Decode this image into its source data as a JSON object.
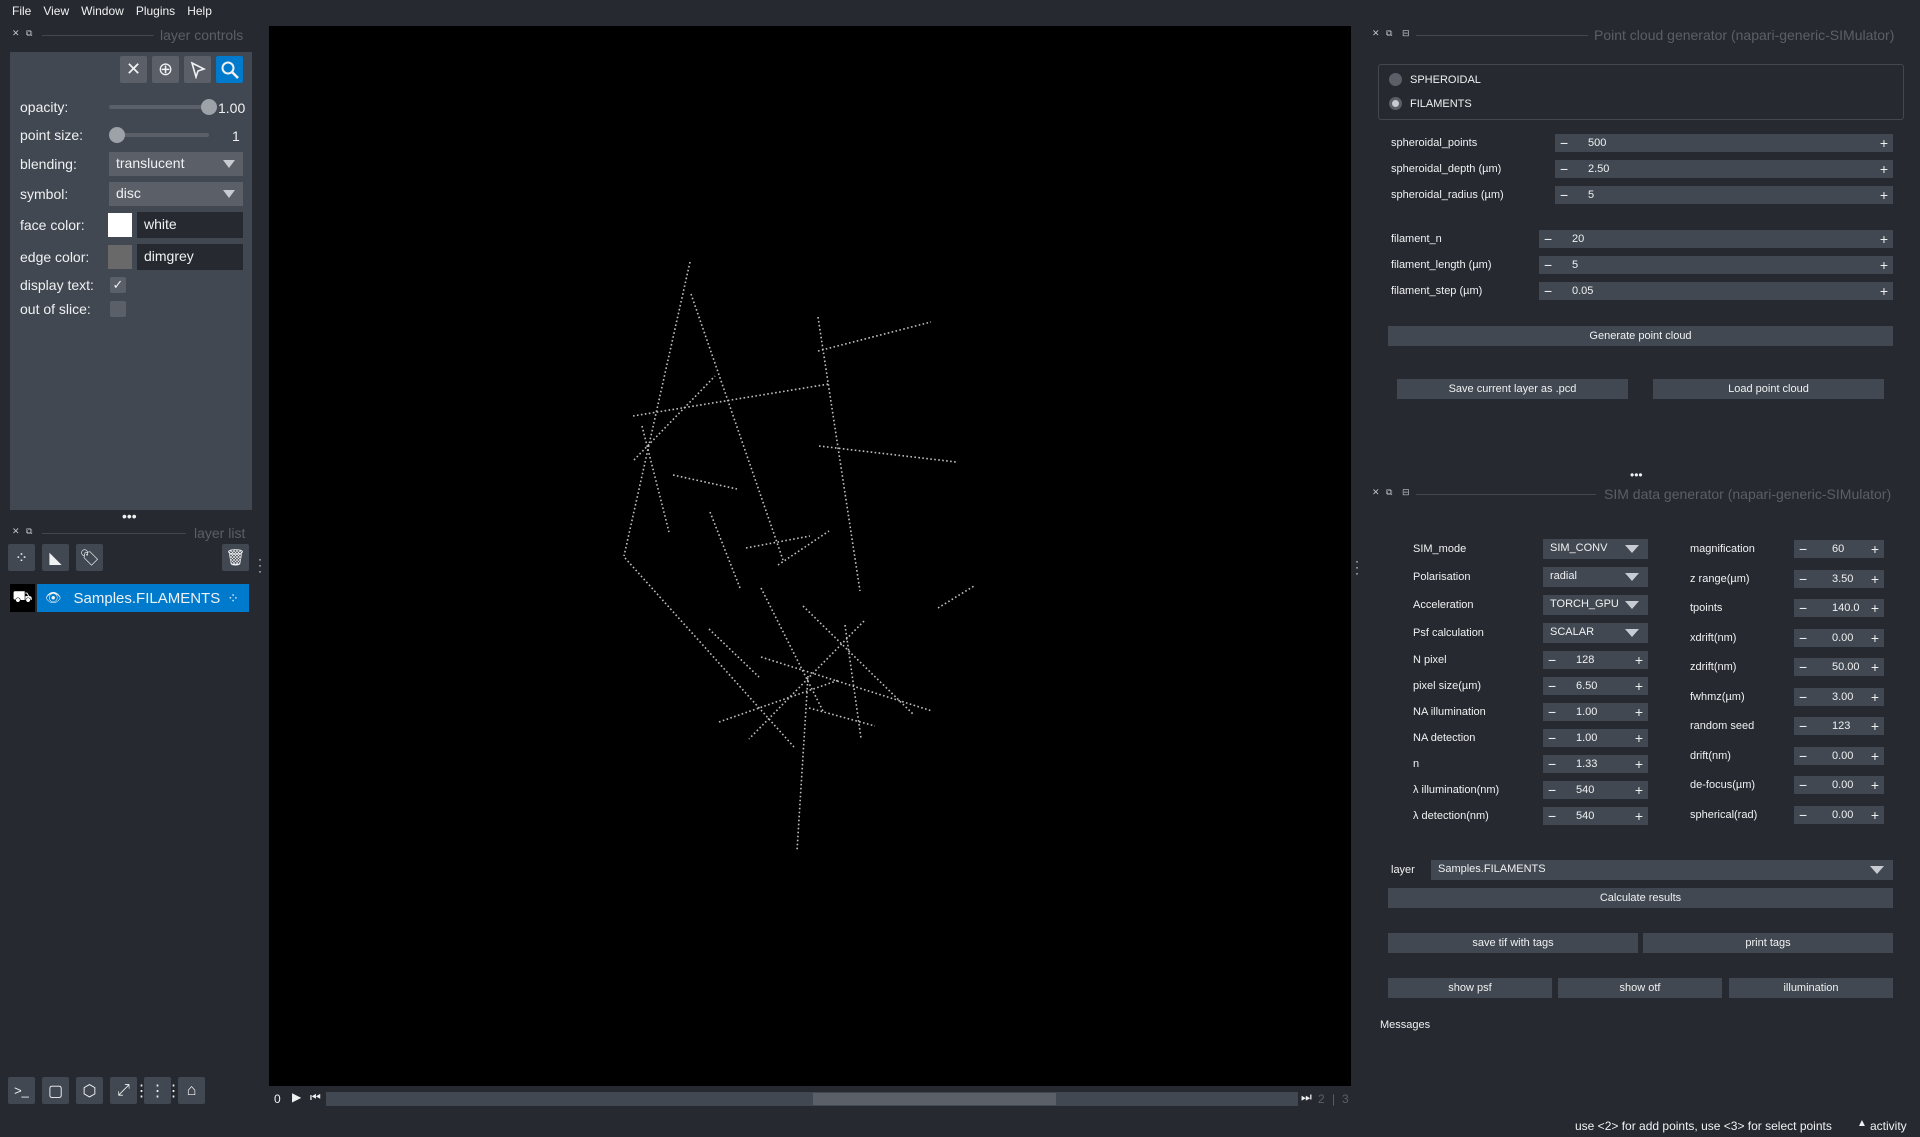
{
  "menu": [
    "File",
    "View",
    "Window",
    "Plugins",
    "Help"
  ],
  "layer_controls": {
    "title": "layer controls",
    "opacity_label": "opacity:",
    "opacity_value": "1.00",
    "opacity_fraction": 1.0,
    "point_size_label": "point size:",
    "point_size_value": "1",
    "blending_label": "blending:",
    "blending_value": "translucent",
    "symbol_label": "symbol:",
    "symbol_value": "disc",
    "face_color_label": "face color:",
    "face_color_value": "white",
    "face_color_hex": "#ffffff",
    "edge_color_label": "edge color:",
    "edge_color_value": "dimgrey",
    "edge_color_hex": "#696969",
    "display_text_label": "display text:",
    "display_text_checked": true,
    "out_of_slice_label": "out of slice:",
    "out_of_slice_checked": false
  },
  "layer_list": {
    "title": "layer list",
    "layers": [
      {
        "name": "Samples.FILAMENTS",
        "visible": true
      }
    ]
  },
  "dims": {
    "current": "0",
    "axis_value": "2",
    "axis_total": "3"
  },
  "point_cloud": {
    "title": "Point cloud generator (napari-generic-SIMulator)",
    "modes": [
      "SPHEROIDAL",
      "FILAMENTS"
    ],
    "selected_mode": "FILAMENTS",
    "params": [
      {
        "label": "spheroidal_points",
        "value": "500"
      },
      {
        "label": "spheroidal_depth (µm)",
        "value": "2.50"
      },
      {
        "label": "spheroidal_radius (µm)",
        "value": "5"
      },
      {
        "label": "filament_n",
        "value": "20"
      },
      {
        "label": "filament_length (µm)",
        "value": "5"
      },
      {
        "label": "filament_step (µm)",
        "value": "0.05"
      }
    ],
    "generate_label": "Generate point cloud",
    "save_label": "Save current layer as .pcd",
    "load_label": "Load point cloud"
  },
  "sim_data": {
    "title": "SIM data generator (napari-generic-SIMulator)",
    "left_combos": [
      {
        "label": "SIM_mode",
        "value": "SIM_CONV"
      },
      {
        "label": "Polarisation",
        "value": "radial"
      },
      {
        "label": "Acceleration",
        "value": "TORCH_GPU"
      },
      {
        "label": "Psf calculation",
        "value": "SCALAR"
      }
    ],
    "left_spins": [
      {
        "label": "N pixel",
        "value": "128"
      },
      {
        "label": "pixel size(µm)",
        "value": "6.50"
      },
      {
        "label": "NA  illumination",
        "value": "1.00"
      },
      {
        "label": "NA  detection",
        "value": "1.00"
      },
      {
        "label": "n",
        "value": "1.33"
      },
      {
        "label": "λ  illumination(nm)",
        "value": "540"
      },
      {
        "label": "λ  detection(nm)",
        "value": "540"
      }
    ],
    "right_spins": [
      {
        "label": "magnification",
        "value": "60"
      },
      {
        "label": "z range(µm)",
        "value": "3.50"
      },
      {
        "label": "tpoints",
        "value": "140.0"
      },
      {
        "label": "xdrift(nm)",
        "value": "0.00"
      },
      {
        "label": "zdrift(nm)",
        "value": "50.00"
      },
      {
        "label": "fwhmz(µm)",
        "value": "3.00"
      },
      {
        "label": "random seed",
        "value": "123"
      },
      {
        "label": "drift(nm)",
        "value": "0.00"
      },
      {
        "label": "de-focus(µm)",
        "value": "0.00"
      },
      {
        "label": "spherical(rad)",
        "value": "0.00"
      }
    ],
    "layer_label": "layer",
    "layer_value": "Samples.FILAMENTS",
    "calculate_label": "Calculate results",
    "save_tif_label": "save tif with tags",
    "print_tags_label": "print tags",
    "show_psf_label": "show psf",
    "show_otf_label": "show otf",
    "illumination_label": "illumination",
    "messages_label": "Messages"
  },
  "status": {
    "hint": "use <2> for add points, use <3> for select points",
    "activity": "activity"
  },
  "colors": {
    "background": "#262930",
    "panel": "#414851",
    "accent": "#007acc",
    "canvas": "#000000"
  }
}
